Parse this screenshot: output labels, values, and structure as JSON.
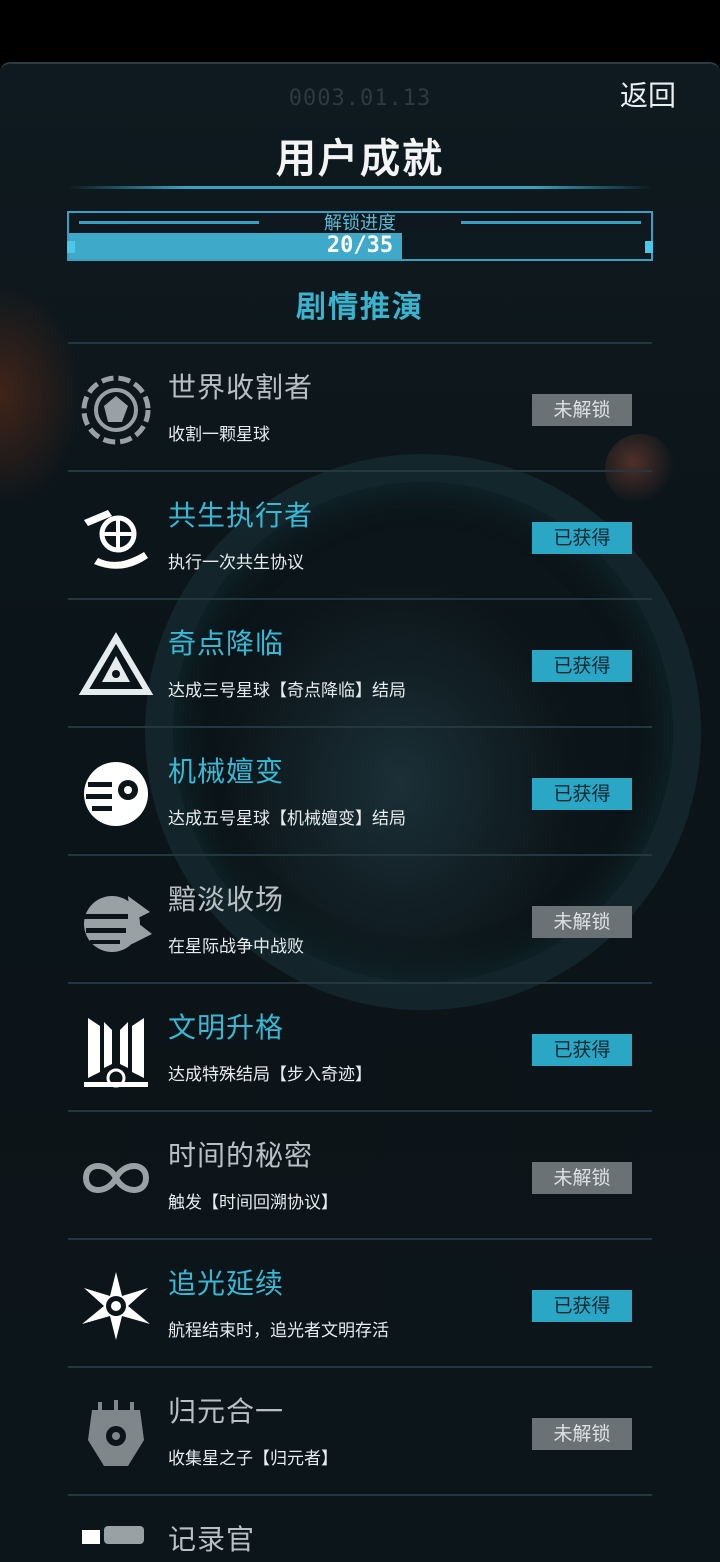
{
  "header": {
    "date": "0003.01.13",
    "back_label": "返回",
    "title": "用户成就"
  },
  "progress": {
    "label": "解锁进度",
    "text": "20/35",
    "unlocked": 20,
    "total": 35,
    "color": "#3ea9c9"
  },
  "section": {
    "title": "剧情推演"
  },
  "status_labels": {
    "locked": "未解锁",
    "unlocked": "已获得"
  },
  "achievements": [
    {
      "name": "世界收割者",
      "desc": "收割一颗星球",
      "status": "未解锁",
      "unlocked": false,
      "icon": "planet-harvest-icon"
    },
    {
      "name": "共生执行者",
      "desc": "执行一次共生协议",
      "status": "已获得",
      "unlocked": true,
      "icon": "globe-hand-icon"
    },
    {
      "name": "奇点降临",
      "desc": "达成三号星球【奇点降临】结局",
      "status": "已获得",
      "unlocked": true,
      "icon": "triangle-eye-icon"
    },
    {
      "name": "机械嬗变",
      "desc": "达成五号星球【机械嬗变】结局",
      "status": "已获得",
      "unlocked": true,
      "icon": "mechanical-eye-icon"
    },
    {
      "name": "黯淡收场",
      "desc": "在星际战争中战败",
      "status": "未解锁",
      "unlocked": false,
      "icon": "broken-planet-icon"
    },
    {
      "name": "文明升格",
      "desc": "达成特殊结局【步入奇迹】",
      "status": "已获得",
      "unlocked": true,
      "icon": "winged-emblem-icon"
    },
    {
      "name": "时间的秘密",
      "desc": "触发【时间回溯协议】",
      "status": "未解锁",
      "unlocked": false,
      "icon": "infinity-icon"
    },
    {
      "name": "追光延续",
      "desc": "航程结束时，追光者文明存活",
      "status": "已获得",
      "unlocked": true,
      "icon": "starburst-icon"
    },
    {
      "name": "归元合一",
      "desc": "收集星之子【归元者】",
      "status": "未解锁",
      "unlocked": false,
      "icon": "mask-icon"
    },
    {
      "name": "记录官",
      "desc": "",
      "status": "",
      "unlocked": false,
      "icon": "recorder-icon"
    }
  ]
}
